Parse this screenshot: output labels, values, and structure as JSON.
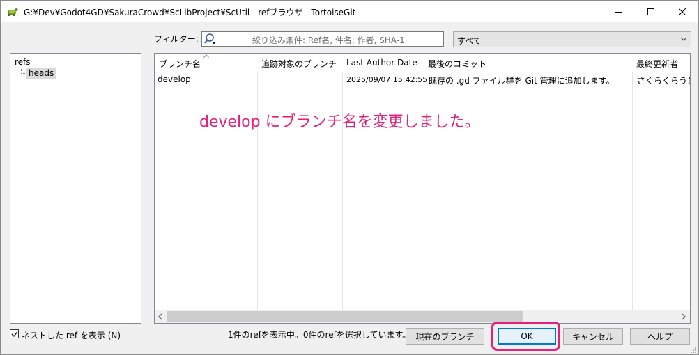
{
  "window": {
    "title": "G:¥Dev¥Godot4GD¥SakuraCrowd¥ScLibProject¥ScUtil - refブラウザ - TortoiseGit",
    "app_icon": "tortoisegit-icon",
    "controls": [
      "minimize-icon",
      "maximize-icon",
      "close-icon"
    ]
  },
  "filter": {
    "label": "フィルター:",
    "placeholder": "絞り込み条件: Ref名, 件名, 作者, SHA-1",
    "search_icon": "magnifier-icon",
    "scope_value": "すべて"
  },
  "tree": {
    "root": "refs",
    "child": "heads"
  },
  "list": {
    "columns": [
      "ブランチ名",
      "追跡対象のブランチ",
      "Last Author Date",
      "最後のコミット",
      "最終更新者"
    ],
    "rows": [
      {
        "branch": "develop",
        "tracked": "",
        "date": "2025/09/07 15:42:55",
        "last_commit": "既存の .gd ファイル群を Git 管理に追加します。",
        "last_updated_by": "さくらくらうど"
      }
    ]
  },
  "annotation": "develop にブランチ名を変更しました。",
  "bottom": {
    "checkbox_label": "ネストした ref を表示 (N)",
    "checkbox_checked": true,
    "status": "1件のrefを表示中。0件のrefを選択しています。",
    "buttons": {
      "current_branch": "現在のブランチ",
      "ok": "OK",
      "cancel": "キャンセル",
      "help": "ヘルプ"
    }
  },
  "colors": {
    "annotation": "#e6207a",
    "ok_border": "#0078d7"
  }
}
